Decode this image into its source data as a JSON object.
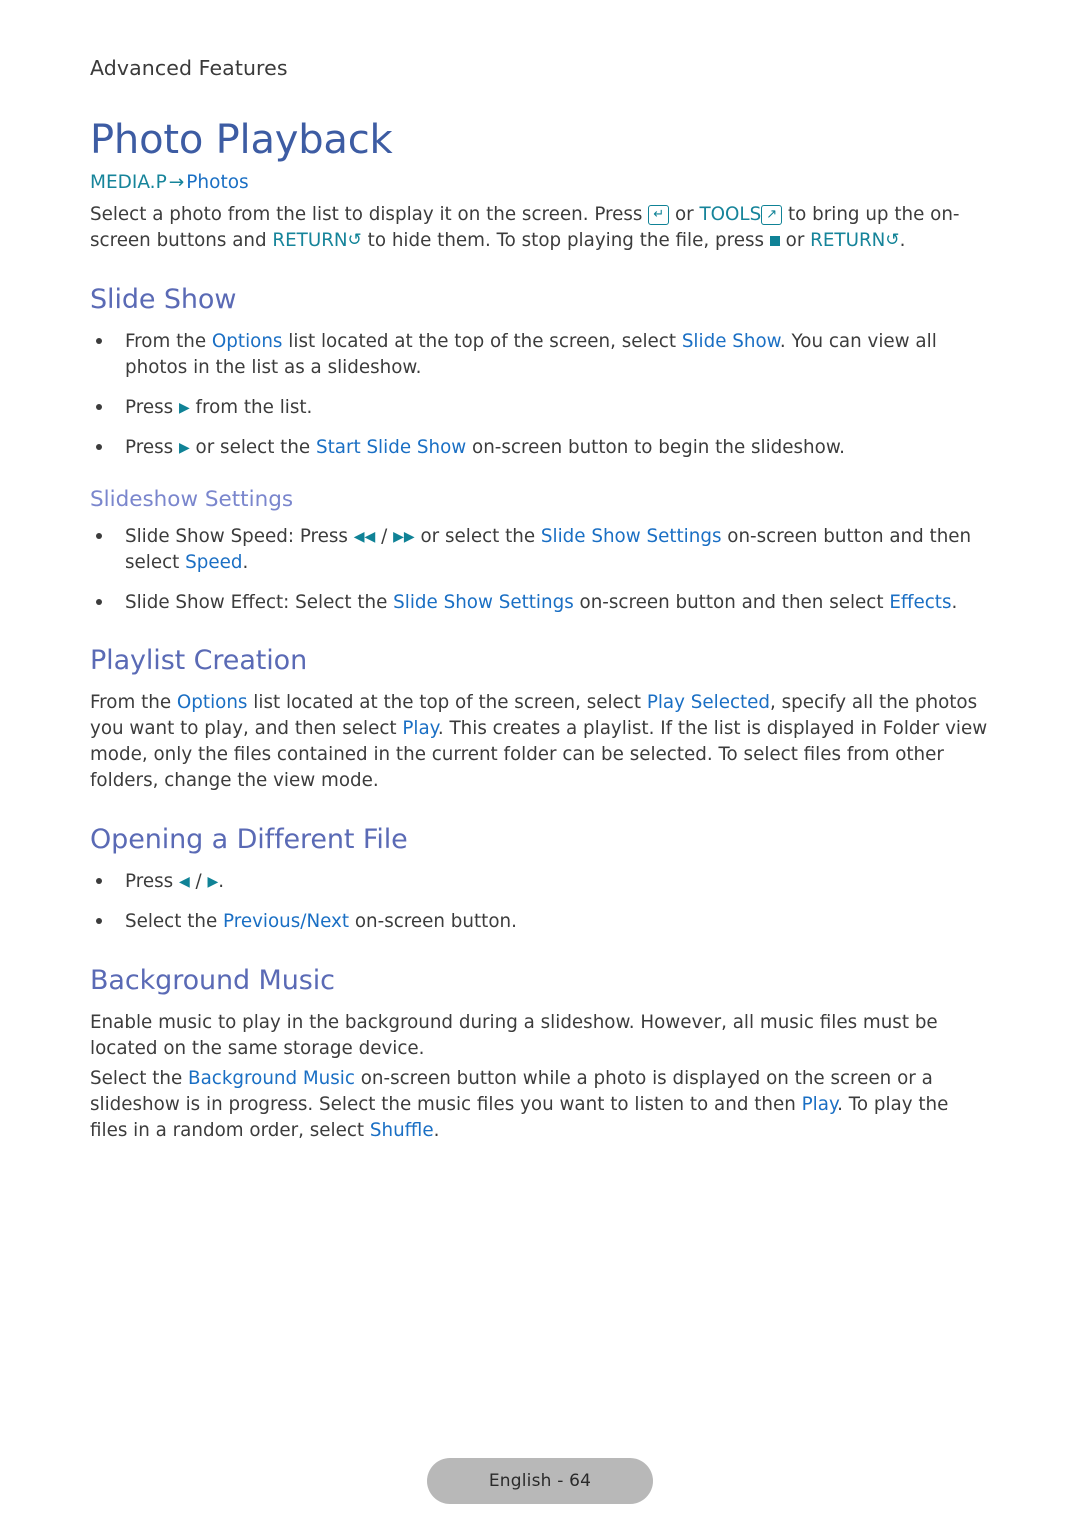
{
  "header": {
    "running_head": "Advanced Features"
  },
  "doc": {
    "title": "Photo Playback",
    "breadcrumb": {
      "root": "MEDIA.P",
      "arrow": "→",
      "leaf": "Photos"
    },
    "intro": {
      "part1": "Select a photo from the list to display it on the screen. Press ",
      "enter_key_icon": "↵",
      "part2": " or ",
      "tools_label": "TOOLS",
      "tools_key_icon": "↗",
      "part3": " to bring up the on-screen buttons and ",
      "return_label": "RETURN",
      "return_icon": "↺",
      "part4": " to hide them. To stop playing the file, press ",
      "stop_icon": "■",
      "part5": " or ",
      "return_label2": "RETURN",
      "return_icon2": "↺",
      "part6": "."
    }
  },
  "sections": {
    "slide_show": {
      "title": "Slide Show",
      "bullets": [
        {
          "a": "From the ",
          "link1": "Options",
          "b": " list located at the top of the screen, select ",
          "link2": "Slide Show",
          "c": ". You can view all photos in the list as a slideshow."
        },
        {
          "a": "Press ",
          "icon": "▶",
          "b": " from the list."
        },
        {
          "a": "Press ",
          "icon": "▶",
          "b": " or select the ",
          "link1": "Start Slide Show",
          "c": " on-screen button to begin the slideshow."
        }
      ],
      "sub": {
        "title": "Slideshow Settings",
        "bullets": [
          {
            "a": "Slide Show Speed: Press ",
            "icon_rew": "◀◀",
            "sep": " / ",
            "icon_ff": "▶▶",
            "b": " or select the ",
            "link1": "Slide Show Settings",
            "c": " on-screen button and then select ",
            "link2": "Speed",
            "d": "."
          },
          {
            "a": "Slide Show Effect: Select the ",
            "link1": "Slide Show Settings",
            "c": " on-screen button and then select ",
            "link2": "Effects",
            "d": "."
          }
        ]
      }
    },
    "playlist_creation": {
      "title": "Playlist Creation",
      "paragraph": {
        "a": "From the ",
        "link1": "Options",
        "b": " list located at the top of the screen, select ",
        "link2": "Play Selected",
        "c": ", specify all the photos you want to play, and then select ",
        "link3": "Play",
        "d": ". This creates a playlist. If the list is displayed in Folder view mode, only the files contained in the current folder can be selected. To select files from other folders, change the view mode."
      }
    },
    "opening_different_file": {
      "title": "Opening a Different File",
      "bullets": [
        {
          "a": "Press ",
          "icon_left": "◀",
          "sep": " / ",
          "icon_right": "▶",
          "b": "."
        },
        {
          "a": "Select the ",
          "link1": "Previous/Next",
          "b": " on-screen button."
        }
      ]
    },
    "background_music": {
      "title": "Background Music",
      "paragraph1": "Enable music to play in the background during a slideshow. However, all music files must be located on the same storage device.",
      "paragraph2": {
        "a": "Select the ",
        "link1": "Background Music",
        "b": " on-screen button while a photo is displayed on the screen or a slideshow is in progress. Select the music files you want to listen to and then ",
        "link2": "Play",
        "c": ". To play the files in a random order, select ",
        "link3": "Shuffle",
        "d": "."
      }
    }
  },
  "footer": {
    "page_label": "English - 64"
  },
  "colors": {
    "title_blue": "#3d5ca3",
    "section_purple": "#5a6ab5",
    "sub_purple": "#7a86cd",
    "link_blue": "#1a6fc4",
    "teal": "#16849a",
    "body": "#3c3c3c",
    "pill_bg": "#b8b8b8"
  }
}
